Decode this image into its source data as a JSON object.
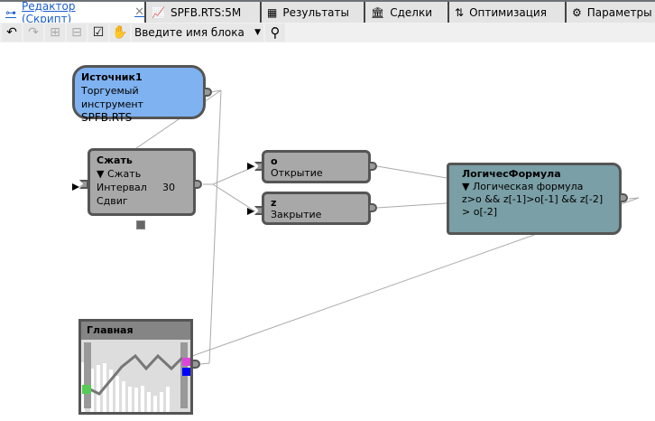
{
  "tabs": [
    {
      "label": "Редактор (Скрипт)",
      "icon": "diagram-icon",
      "active": true
    },
    {
      "label": "SPFB.RTS:5M",
      "icon": "chart-icon"
    },
    {
      "label": "Результаты",
      "icon": "table-icon"
    },
    {
      "label": "Сделки",
      "icon": "bank-icon"
    },
    {
      "label": "Оптимизация",
      "icon": "sliders-icon"
    },
    {
      "label": "Параметры",
      "icon": "gear-icon"
    }
  ],
  "toolbar": {
    "block_search_placeholder": "Введите имя блока"
  },
  "nodes": {
    "source": {
      "title": "Источник1",
      "label": "Торгуемый инструмент",
      "value": "SPFB.RTS",
      "color": "#7fb2f0"
    },
    "compress": {
      "title": "Сжать",
      "dropdown": "Сжать",
      "interval_label": "Интервал",
      "interval_value": "30",
      "shift_label": "Сдвиг"
    },
    "open": {
      "title": "o",
      "label": "Открытие"
    },
    "close": {
      "title": "z",
      "label": "Закрытие"
    },
    "formula": {
      "title": "ЛогичесФормула",
      "dropdown": "Логическая формула",
      "line1": "z>o && z[-1]>o[-1] && z[-2]",
      "line2": "> o[-2]",
      "color": "#7a9fa6"
    },
    "main": {
      "title": "Главная"
    }
  }
}
